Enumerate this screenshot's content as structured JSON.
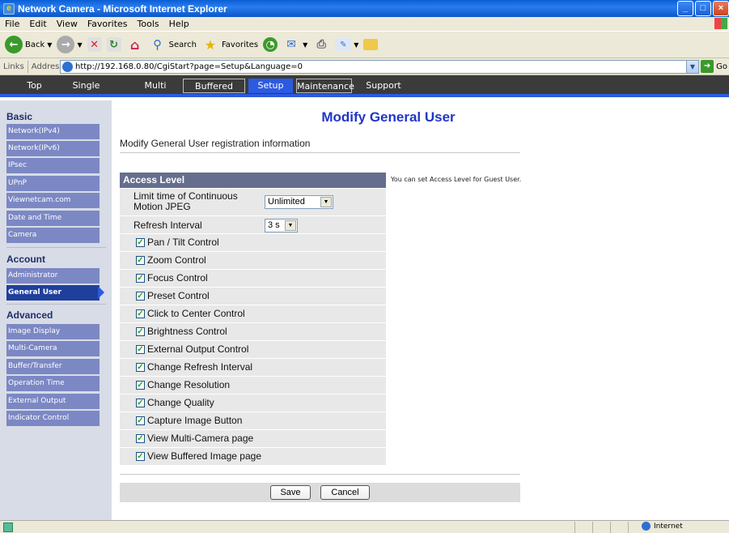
{
  "window": {
    "title": "Network Camera - Microsoft Internet Explorer"
  },
  "menu": [
    "File",
    "Edit",
    "View",
    "Favorites",
    "Tools",
    "Help"
  ],
  "toolbar": {
    "back": "Back",
    "search": "Search",
    "favorites": "Favorites"
  },
  "address": {
    "links_label": "Links",
    "address_label": "Address",
    "url": "http://192.168.0.80/CgiStart?page=Setup&Language=0",
    "go": "Go"
  },
  "nav": {
    "tabs": [
      "Top",
      "Single",
      "Multi",
      "Buffered Image",
      "Setup",
      "Maintenance",
      "Support"
    ],
    "selected": "Setup"
  },
  "sidebar": {
    "basic": {
      "title": "Basic",
      "items": [
        "Network(IPv4)",
        "Network(IPv6)",
        "IPsec",
        "UPnP",
        "Viewnetcam.com",
        "Date and Time",
        "Camera"
      ]
    },
    "account": {
      "title": "Account",
      "items": [
        "Administrator",
        "General User"
      ],
      "selected": "General User"
    },
    "advanced": {
      "title": "Advanced",
      "items": [
        "Image Display",
        "Multi-Camera",
        "Buffer/Transfer",
        "Operation Time",
        "External Output",
        "Indicator Control"
      ]
    }
  },
  "main": {
    "title": "Modify General User",
    "subtitle": "Modify General User registration information",
    "access_level": {
      "heading": "Access Level",
      "hint": "You can set Access Level for Guest User.",
      "limit_label": "Limit time of Continuous Motion JPEG",
      "limit_value": "Unlimited",
      "refresh_label": "Refresh Interval",
      "refresh_value": "3 s",
      "checkboxes": [
        {
          "label": "Pan / Tilt Control",
          "checked": true
        },
        {
          "label": "Zoom Control",
          "checked": true
        },
        {
          "label": "Focus Control",
          "checked": true
        },
        {
          "label": "Preset Control",
          "checked": true
        },
        {
          "label": "Click to Center Control",
          "checked": true
        },
        {
          "label": "Brightness Control",
          "checked": true
        },
        {
          "label": "External Output Control",
          "checked": true
        },
        {
          "label": "Change Refresh Interval",
          "checked": true
        },
        {
          "label": "Change Resolution",
          "checked": true
        },
        {
          "label": "Change Quality",
          "checked": true
        },
        {
          "label": "Capture Image Button",
          "checked": true
        },
        {
          "label": "View Multi-Camera page",
          "checked": true
        },
        {
          "label": "View Buffered Image page",
          "checked": true
        }
      ]
    },
    "buttons": {
      "save": "Save",
      "cancel": "Cancel"
    }
  },
  "status": {
    "zone": "Internet"
  }
}
